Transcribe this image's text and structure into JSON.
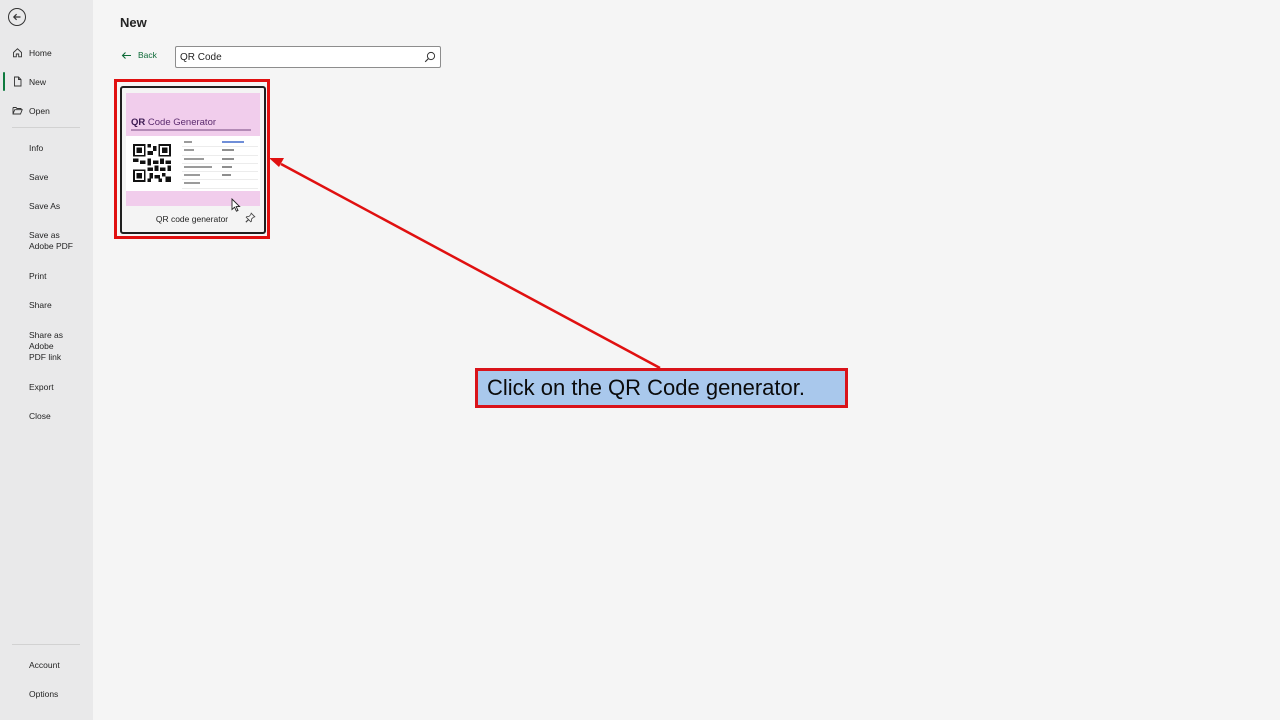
{
  "window": {
    "page_title": "New"
  },
  "sidebar": {
    "top_items": [
      {
        "label": "Home",
        "icon": "home-icon"
      },
      {
        "label": "New",
        "icon": "new-document-icon",
        "active": true
      },
      {
        "label": "Open",
        "icon": "folder-open-icon"
      }
    ],
    "sub_items": [
      "Info",
      "Save",
      "Save As",
      "Save as Adobe PDF",
      "Print",
      "Share",
      "Share as Adobe PDF link",
      "Export",
      "Close"
    ],
    "bottom_items": [
      "Account",
      "Options"
    ]
  },
  "main": {
    "back_label": "Back",
    "search": {
      "value": "QR Code"
    },
    "templates": [
      {
        "label": "QR code generator",
        "thumbnail_title_bold": "QR",
        "thumbnail_title_rest": " Code Generator"
      }
    ]
  },
  "annotation": {
    "text": "Click on the QR Code generator."
  },
  "colors": {
    "accent": "#0e7a3e",
    "highlight_red": "#e01010",
    "callout_fill": "#a9c8ec",
    "thumbnail_pink": "#f1cdec"
  }
}
